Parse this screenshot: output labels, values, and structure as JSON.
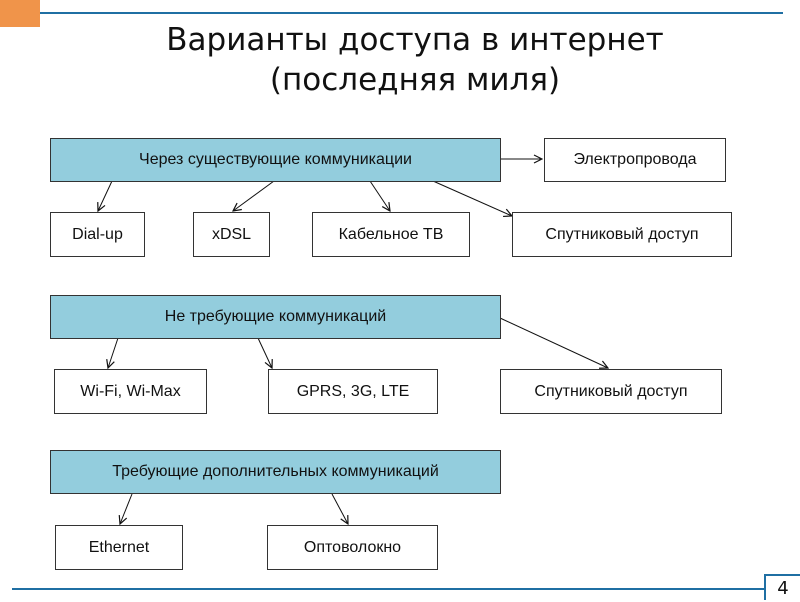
{
  "slide": {
    "title_line1": "Варианты доступа в интернет",
    "title_line2": "(последняя миля)",
    "page_number": "4",
    "colors": {
      "accent": "#f0944a",
      "rule": "#1f6fa3",
      "category_fill": "#93cddd"
    }
  },
  "diagram": {
    "groups": [
      {
        "category": "Через существующие коммуникации",
        "side_item": "Электропровода",
        "items": [
          "Dial-up",
          "xDSL",
          "Кабельное ТВ",
          "Спутниковый доступ"
        ]
      },
      {
        "category": "Не требующие коммуникаций",
        "items": [
          "Wi-Fi, Wi-Max",
          "GPRS, 3G, LTE",
          "Спутниковый доступ"
        ]
      },
      {
        "category": "Требующие дополнительных коммуникаций",
        "items": [
          "Ethernet",
          "Оптоволокно"
        ]
      }
    ]
  }
}
